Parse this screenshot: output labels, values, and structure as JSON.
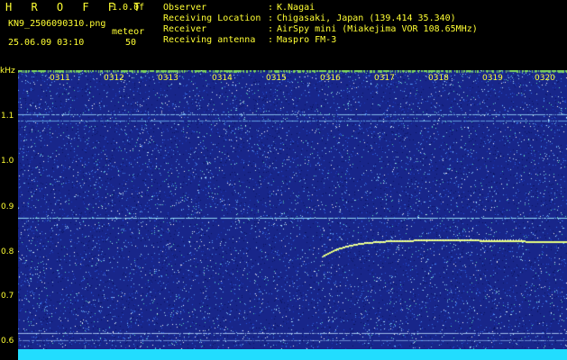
{
  "header": {
    "app_title": "H R O F F T",
    "version": "1.0.0f",
    "filename": "KN9_2506090310.png",
    "timestamp": "25.06.09 03:10",
    "meteor_label": "meteor",
    "meteor_count": "50"
  },
  "info": [
    {
      "label": "Observer",
      "value": "K.Nagai"
    },
    {
      "label": "Receiving Location",
      "value": "Chigasaki, Japan (139.414 35.340)"
    },
    {
      "label": "Receiver",
      "value": "AirSpy mini (Miakejima VOR 108.65MHz)"
    },
    {
      "label": "Receiving antenna",
      "value": "Maspro FM-3"
    }
  ],
  "colon": ":",
  "y_axis": {
    "unit": "kHz",
    "ticks": [
      "1.1",
      "1.0",
      "0.9",
      "0.8",
      "0.7",
      "0.6"
    ]
  },
  "x_axis": {
    "ticks": [
      "0311",
      "0312",
      "0313",
      "0314",
      "0315",
      "0316",
      "0317",
      "0318",
      "0319",
      "0320"
    ]
  },
  "colors": {
    "background_noise": "#1a2a8a",
    "signal": "#e8ff80",
    "bottom_bar": "#22ddff",
    "text": "#ffff33"
  }
}
